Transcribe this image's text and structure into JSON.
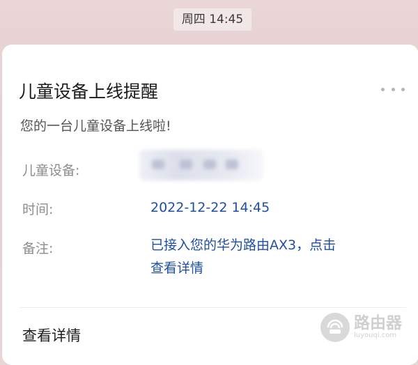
{
  "header": {
    "time_chip": "周四 14:45"
  },
  "card": {
    "title": "儿童设备上线提醒",
    "subtitle": "您的一台儿童设备上线啦!",
    "more_icon": "more-horizontal-icon",
    "fields": [
      {
        "label": "儿童设备:",
        "value": ""
      },
      {
        "label": "时间:",
        "value": "2022-12-22 14:45"
      },
      {
        "label": "备注:",
        "value_line1": "已接入您的华为路由AX3，点击",
        "value_line2": "查看详情"
      }
    ],
    "footer_link": "查看详情"
  },
  "watermark": {
    "main": "路由器",
    "sub": "luyouqi.com",
    "icon": "router-logo-icon"
  },
  "colors": {
    "accent_link": "#1f4fa5",
    "label_gray": "#8d8d8d",
    "background": "#e6d1d2"
  }
}
